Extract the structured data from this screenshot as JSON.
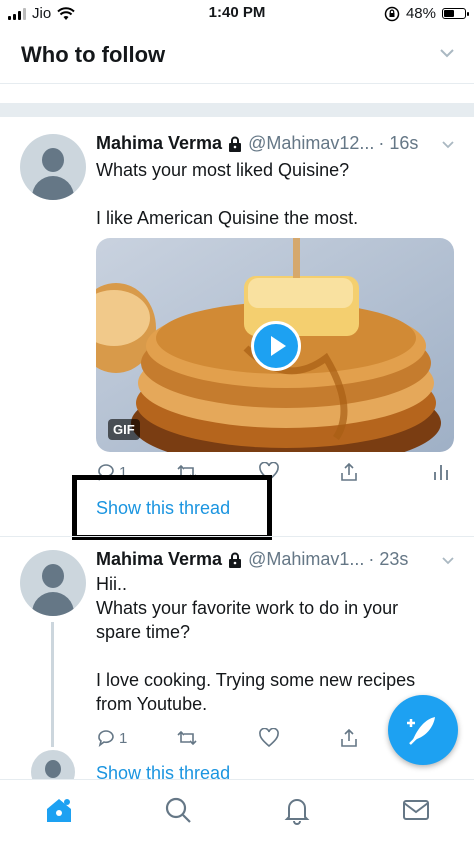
{
  "status_bar": {
    "carrier": "Jio",
    "time": "1:40 PM",
    "battery": "48%",
    "battery_level": 0.48
  },
  "header": {
    "title": "Who to follow"
  },
  "tweets": [
    {
      "name": "Mahima Verma",
      "handle": "@Mahimav12...",
      "time": "· 16s",
      "lines": [
        "Whats your most liked Quisine?",
        "",
        "I like American Quisine the most."
      ],
      "media_badge": "GIF",
      "reply_count": "1",
      "show_thread": "Show this thread"
    },
    {
      "name": "Mahima Verma",
      "handle": "@Mahimav1...",
      "time": "· 23s",
      "lines": [
        "Hii..",
        "Whats your favorite work to do in your spare time?",
        "",
        "I love cooking. Trying some new recipes from Youtube."
      ],
      "reply_count": "1",
      "show_thread": "Show this thread"
    }
  ],
  "colors": {
    "accent": "#1da1f2",
    "link": "#1b95e0",
    "muted": "#657786",
    "divider": "#e6ecf0"
  },
  "nav": [
    "home-icon",
    "search-icon",
    "notifications-icon",
    "messages-icon"
  ]
}
